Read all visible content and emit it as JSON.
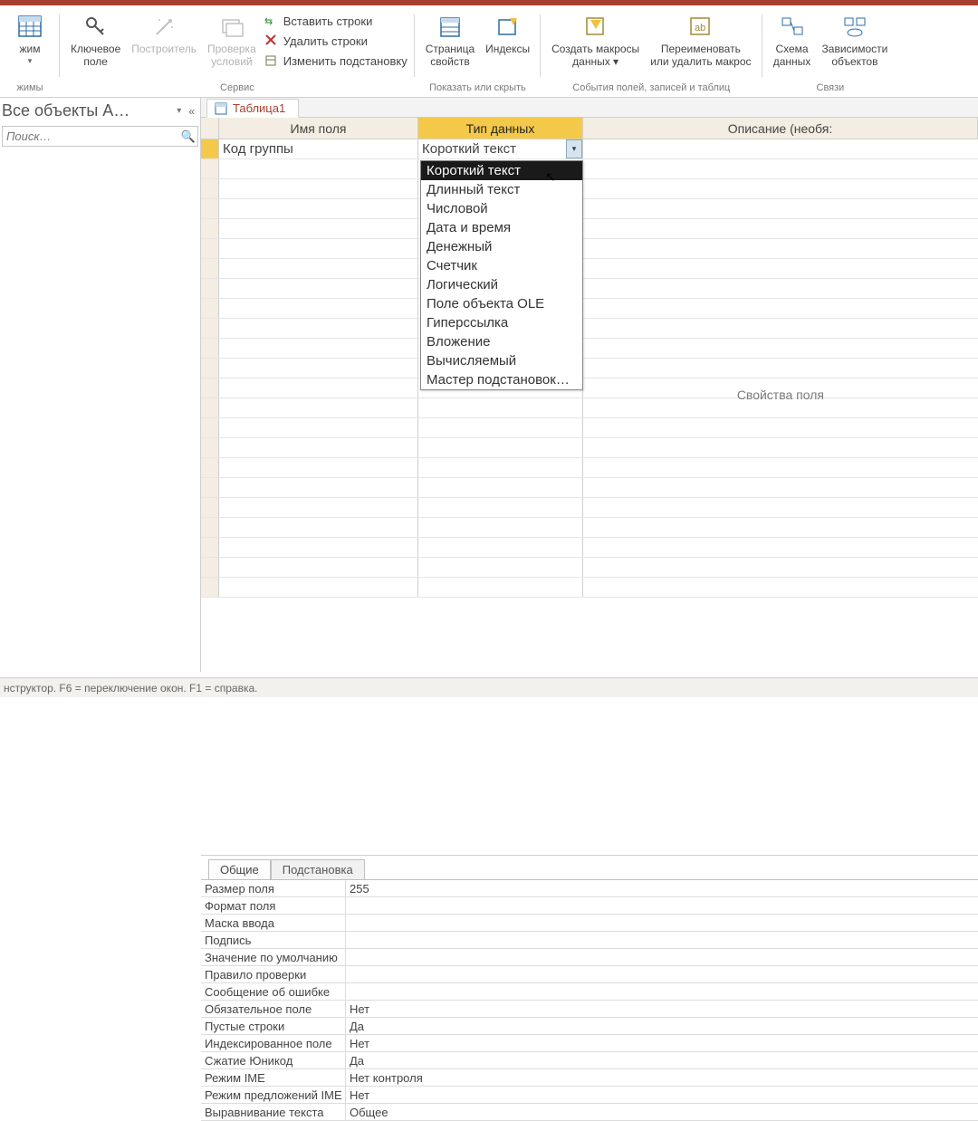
{
  "ribbon": {
    "mode": {
      "label": "жим"
    },
    "group_modes": "жимы",
    "key_field": "Ключевое\nполе",
    "builder": "Построитель",
    "validation": "Проверка\nусловий",
    "insert_rows": "Вставить строки",
    "delete_rows": "Удалить строки",
    "modify_lookups": "Изменить подстановку",
    "group_service": "Сервис",
    "property_sheet": "Страница\nсвойств",
    "indexes": "Индексы",
    "group_show_hide": "Показать или скрыть",
    "create_macros": "Создать макросы\nданных ▾",
    "rename_delete": "Переименовать\nили удалить макрос",
    "group_events": "События полей, записей и таблиц",
    "relationships": "Схема\nданных",
    "dependencies": "Зависимости\nобъектов",
    "group_links": "Связи"
  },
  "sidebar": {
    "title": "Все объекты А…",
    "search_placeholder": "Поиск…"
  },
  "tab": {
    "name": "Таблица1"
  },
  "grid": {
    "header_name": "Имя поля",
    "header_type": "Тип данных",
    "header_desc": "Описание (необя:",
    "row1_name": "Код группы",
    "row1_type": "Короткий текст",
    "datatype_options": [
      "Короткий текст",
      "Длинный текст",
      "Числовой",
      "Дата и время",
      "Денежный",
      "Счетчик",
      "Логический",
      "Поле объекта OLE",
      "Гиперссылка",
      "Вложение",
      "Вычисляемый",
      "Мастер подстановок…"
    ]
  },
  "props": {
    "label": "Свойства поля",
    "tab_general": "Общие",
    "tab_lookup": "Подстановка",
    "rows": [
      {
        "k": "Размер поля",
        "v": "255"
      },
      {
        "k": "Формат поля",
        "v": ""
      },
      {
        "k": "Маска ввода",
        "v": ""
      },
      {
        "k": "Подпись",
        "v": ""
      },
      {
        "k": "Значение по умолчанию",
        "v": ""
      },
      {
        "k": "Правило проверки",
        "v": ""
      },
      {
        "k": "Сообщение об ошибке",
        "v": ""
      },
      {
        "k": "Обязательное поле",
        "v": "Нет"
      },
      {
        "k": "Пустые строки",
        "v": "Да"
      },
      {
        "k": "Индексированное поле",
        "v": "Нет"
      },
      {
        "k": "Сжатие Юникод",
        "v": "Да"
      },
      {
        "k": "Режим IME",
        "v": "Нет контроля"
      },
      {
        "k": "Режим предложений IME",
        "v": "Нет"
      },
      {
        "k": "Выравнивание текста",
        "v": "Общее"
      }
    ]
  },
  "statusbar": "нструктор.  F6 = переключение окон.  F1 = справка."
}
